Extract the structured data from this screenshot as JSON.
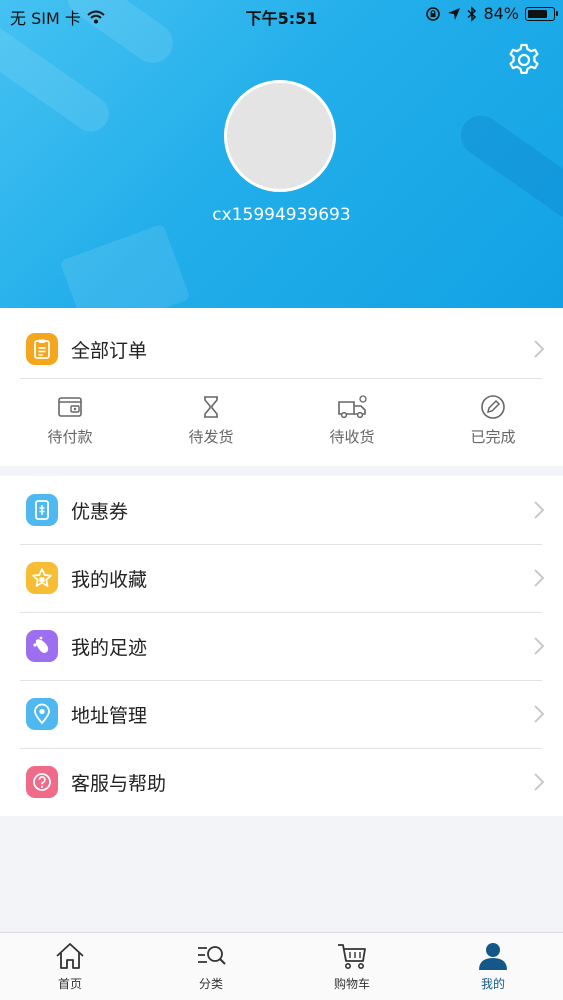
{
  "status_bar": {
    "carrier": "无 SIM 卡",
    "time": "下午5:51",
    "battery_percent": "84%",
    "battery_level": 0.84
  },
  "profile": {
    "username": "cx15994939693"
  },
  "orders": {
    "all_orders_label": "全部订单",
    "statuses": [
      {
        "label": "待付款",
        "icon": "wallet-icon"
      },
      {
        "label": "待发货",
        "icon": "hourglass-icon"
      },
      {
        "label": "待收货",
        "icon": "truck-icon"
      },
      {
        "label": "已完成",
        "icon": "done-pen-icon"
      }
    ]
  },
  "menu": {
    "items": [
      {
        "label": "优惠券",
        "icon": "coupon-icon",
        "color": "#4fb8ee"
      },
      {
        "label": "我的收藏",
        "icon": "favorite-star-icon",
        "color": "#f7bd35"
      },
      {
        "label": "我的足迹",
        "icon": "footprint-icon",
        "color": "#9d6ff0"
      },
      {
        "label": "地址管理",
        "icon": "location-pin-icon",
        "color": "#4fb8ee"
      },
      {
        "label": "客服与帮助",
        "icon": "help-icon",
        "color": "#f06a8a"
      }
    ]
  },
  "tabbar": {
    "items": [
      {
        "label": "首页",
        "icon": "home-icon"
      },
      {
        "label": "分类",
        "icon": "category-search-icon"
      },
      {
        "label": "购物车",
        "icon": "cart-icon"
      },
      {
        "label": "我的",
        "icon": "profile-icon"
      }
    ],
    "active_index": 3
  },
  "colors": {
    "header_blue": "#22aeea",
    "orders_icon_orange": "#f4a71c",
    "active_tab": "#14588a"
  }
}
